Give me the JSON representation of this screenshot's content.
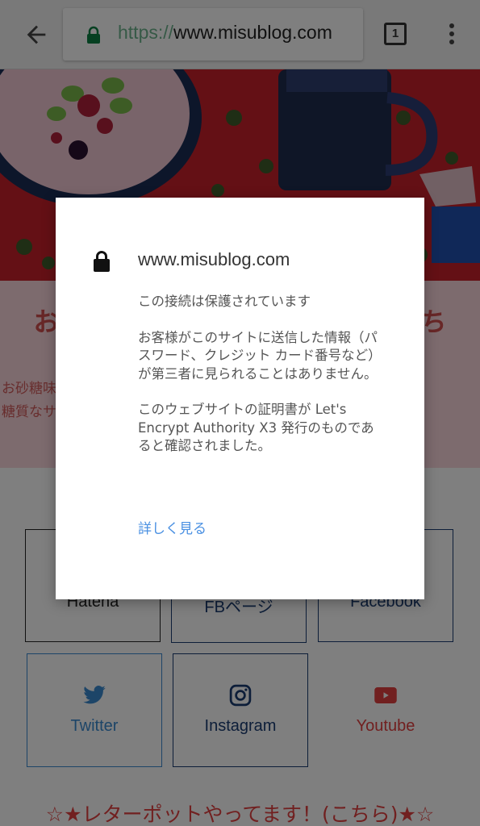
{
  "browser": {
    "url_scheme": "https://",
    "url_host": "www.misublog.com",
    "tab_count": "1",
    "icons": {
      "back": "arrow-left-icon",
      "secure": "lock-icon",
      "tabs": "tab-switcher-icon",
      "menu": "more-vert-icon"
    }
  },
  "page": {
    "intro_title": "お砂　　　　　　　　　　　　うち",
    "intro_text_line1": "お砂糖味　　　　　　　　　　　　　　　　ク飯や低",
    "intro_text_line2": "糖質なサ　　　　　　　　　　　　　　　ーシピを",
    "social_buttons": [
      {
        "label": "Hatena",
        "icon": "hatena-icon"
      },
      {
        "label": "FBページ",
        "icon": "facebook-page-icon"
      },
      {
        "label": "Facebook",
        "icon": "facebook-icon"
      },
      {
        "label": "Twitter",
        "icon": "twitter-icon"
      },
      {
        "label": "Instagram",
        "icon": "instagram-icon"
      },
      {
        "label": "Youtube",
        "icon": "youtube-icon"
      }
    ],
    "letterpot_link": "☆★レターポットやってます！(こちら)★☆"
  },
  "dialog": {
    "title": "www.misublog.com",
    "status": "この接続は保護されています",
    "description": "お客様がこのサイトに送信した情報（パスワード、クレジット カード番号など）が第三者に見られることはありません。",
    "certificate": "このウェブサイトの証明書が Let's Encrypt Authority X3 発行のものであると確認されました。",
    "details_link": "詳しく見る"
  },
  "colors": {
    "secure_green": "#0b8043",
    "link_blue": "#4a90e2",
    "accent_red": "#e24040",
    "twitter_blue": "#3a8bd0",
    "navy": "#1b3c73"
  }
}
